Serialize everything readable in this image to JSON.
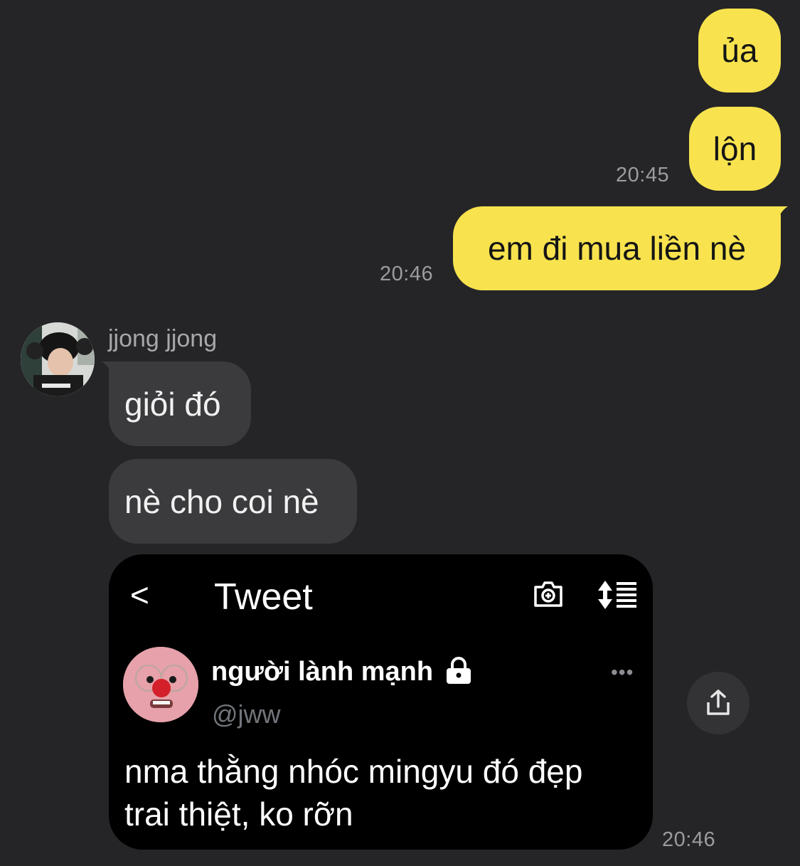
{
  "messages_out": [
    {
      "text": "ủa"
    },
    {
      "text": "lộn",
      "time": "20:45"
    },
    {
      "text": "em đi mua liền nè",
      "time": "20:46"
    }
  ],
  "sender": {
    "name": "jjong jjong",
    "avatar_icon": "profile-photo"
  },
  "messages_in": [
    {
      "text": "giỏi đó"
    },
    {
      "text": "nè cho coi nè"
    }
  ],
  "shared_tweet": {
    "header_title": "Tweet",
    "back_glyph": "<",
    "author_name": "người lành mạnh",
    "author_handle": "@jww",
    "more_glyph": "•••",
    "text": "nma thằng nhóc mingyu đó đẹp trai thiệt, ko rỡn",
    "time": "20:46"
  },
  "colors": {
    "background": "#252527",
    "bubble_out": "#f8e34e",
    "bubble_in": "#3b3b3d",
    "timestamp": "#9c9c9e"
  }
}
